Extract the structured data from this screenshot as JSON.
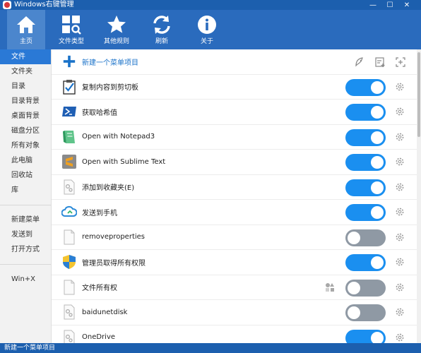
{
  "window": {
    "title": "Windows右键管理",
    "minimize": "—",
    "maximize": "☐",
    "close": "✕"
  },
  "toolbar": [
    {
      "label": "主页",
      "icon": "home-icon"
    },
    {
      "label": "文件类型",
      "icon": "file-types-icon"
    },
    {
      "label": "其他规则",
      "icon": "star-icon"
    },
    {
      "label": "刷新",
      "icon": "refresh-icon"
    },
    {
      "label": "关于",
      "icon": "info-icon"
    }
  ],
  "sidebar": {
    "group1": [
      "文件",
      "文件夹",
      "目录",
      "目录背景",
      "桌面背景",
      "磁盘分区",
      "所有对象",
      "此电脑",
      "回收站",
      "库"
    ],
    "group2": [
      "新建菜单",
      "发送到",
      "打开方式"
    ],
    "group3": [
      "Win+X"
    ],
    "active": "文件"
  },
  "main": {
    "new_item_label": "新建一个菜单项目",
    "rows": [
      {
        "name": "复制内容到剪切板",
        "on": true,
        "icon": "clipboard-check-icon"
      },
      {
        "name": "获取哈希值",
        "on": true,
        "icon": "powershell-icon"
      },
      {
        "name": "Open with Notepad3",
        "on": true,
        "icon": "notepad-icon"
      },
      {
        "name": "Open with Sublime Text",
        "on": true,
        "icon": "sublime-icon"
      },
      {
        "name": "添加到收藏夹(E)",
        "on": true,
        "icon": "generic-file-icon"
      },
      {
        "name": "发送到手机",
        "on": true,
        "icon": "cloud-icon"
      },
      {
        "name": "removeproperties",
        "on": false,
        "icon": "blank-file-icon"
      },
      {
        "name": "管理员取得所有权限",
        "on": true,
        "icon": "shield-icon"
      },
      {
        "name": "文件所有权",
        "on": false,
        "icon": "blank-file-icon",
        "extra_icon": "shapes-icon"
      },
      {
        "name": "baidunetdisk",
        "on": false,
        "icon": "generic-file-icon"
      },
      {
        "name": "OneDrive",
        "on": true,
        "icon": "generic-file-icon"
      }
    ]
  },
  "status": {
    "text": "新建一个菜单项目"
  },
  "colors": {
    "accent": "#1a8ff0",
    "toolbar": "#2a6bbd",
    "titlebar": "#1c5fae",
    "toggle_off": "#8f99a4"
  }
}
